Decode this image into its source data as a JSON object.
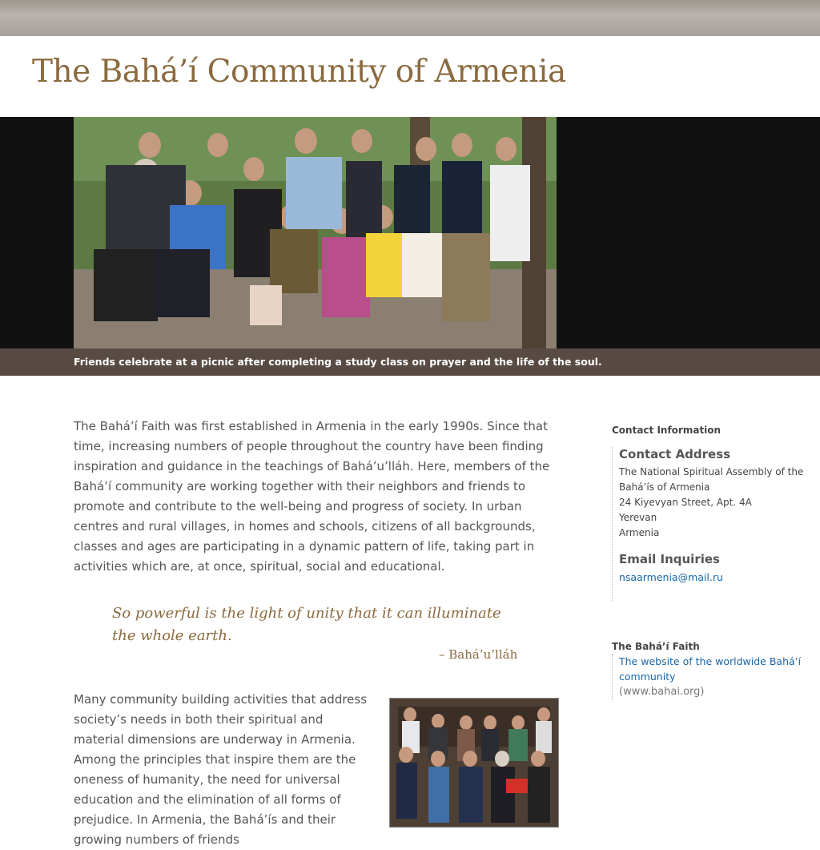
{
  "header": {
    "title": "The Bahá’í Community of Armenia"
  },
  "hero": {
    "caption": "Friends celebrate at a picnic after completing a study class on prayer and the life of the soul."
  },
  "article": {
    "intro": "The Bahá’í Faith was first established in Armenia in the early 1990s. Since that time, increasing numbers of people throughout the country have been finding inspiration and guidance in the teachings of Bahá’u’lláh. Here, members of the Bahá’í community are working together with their neighbors and friends to promote and contribute to the well-being and progress of society. In urban centres and rural villages, in homes and schools, citizens of all backgrounds, classes and ages are participating in a dynamic pattern of life, taking part in activities which are, at once, spiritual, social and educational.",
    "quote": "So powerful is the light of unity that it can illuminate the whole earth.",
    "quote_attribution": "– Bahá’u’lláh",
    "para2": "Many community building activities that address society’s needs in both their spiritual and material dimensions are underway in Armenia. Among the principles that inspire them are the oneness of humanity, the need for universal education and the elimination of all forms of prejudice. In Armenia, the Bahá’ís and their growing numbers of friends"
  },
  "sidebar": {
    "contact_heading": "Contact Information",
    "address_title": "Contact Address",
    "address_lines": [
      "The National Spiritual Assembly of the Bahá’ís of Armenia",
      "24 Kiyevyan Street, Apt. 4A",
      "Yerevan",
      "Armenia"
    ],
    "email_title": "Email Inquiries",
    "email": "nsaarmenia@mail.ru",
    "faith_heading": "The Bahá’í Faith",
    "faith_link": "The website of the worldwide Bahá’í community",
    "faith_url": "(www.bahai.org)"
  },
  "colors": {
    "title": "#8b6a3e",
    "caption_bar": "#584b43",
    "link": "#1a66a6"
  }
}
